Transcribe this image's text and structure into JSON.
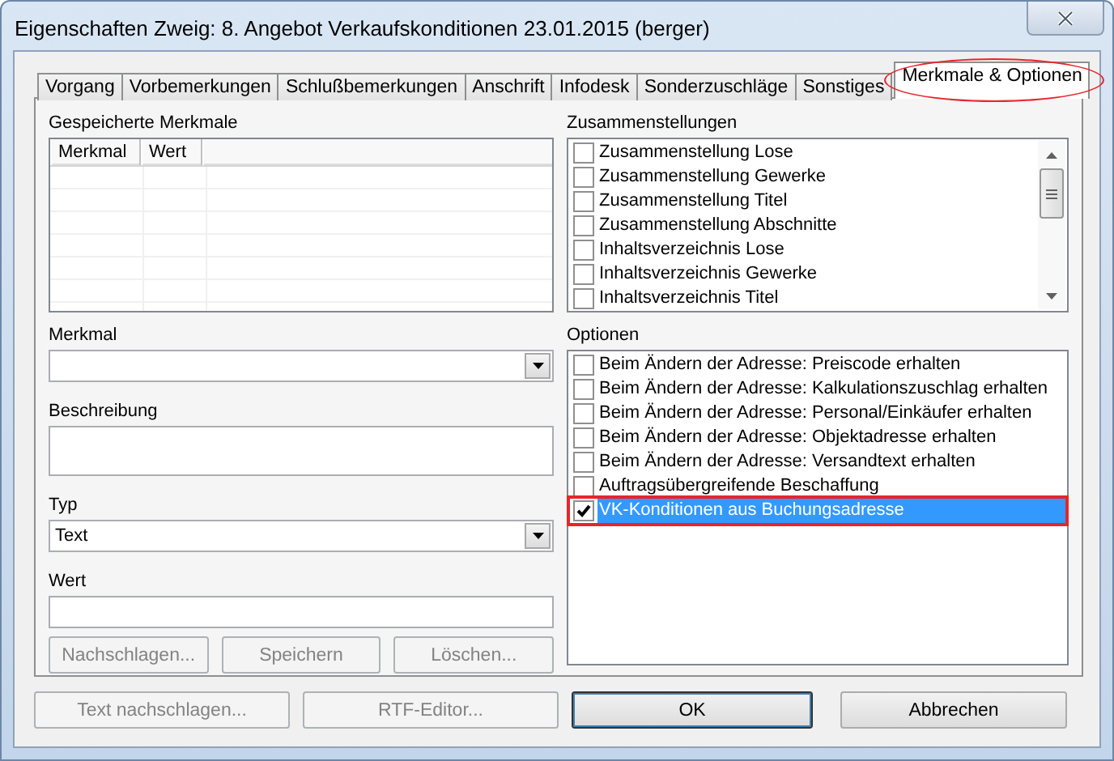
{
  "window": {
    "title": "Eigenschaften Zweig: 8. Angebot Verkaufskonditionen 23.01.2015 (berger)"
  },
  "tabs": [
    {
      "label": "Vorgang",
      "selected": false,
      "circled": false
    },
    {
      "label": "Vorbemerkungen",
      "selected": false,
      "circled": false
    },
    {
      "label": "Schlußbemerkungen",
      "selected": false,
      "circled": false
    },
    {
      "label": "Anschrift",
      "selected": false,
      "circled": false
    },
    {
      "label": "Infodesk",
      "selected": false,
      "circled": false
    },
    {
      "label": "Sonderzuschläge",
      "selected": false,
      "circled": false
    },
    {
      "label": "Sonstiges",
      "selected": false,
      "circled": false
    },
    {
      "label": "Merkmale & Optionen",
      "selected": true,
      "circled": true
    }
  ],
  "saved_features": {
    "label": "Gespeicherte Merkmale",
    "columns": [
      "Merkmal",
      "Wert"
    ]
  },
  "fields": [
    {
      "kind": "combo",
      "label": "Merkmal"
    },
    {
      "kind": "textarea",
      "label": "Beschreibung"
    },
    {
      "kind": "combo",
      "label": "Typ",
      "value": "Text"
    },
    {
      "kind": "text",
      "label": "Wert"
    }
  ],
  "field_buttons": [
    {
      "label": "Nachschlagen...",
      "disabled": true
    },
    {
      "label": "Speichern",
      "disabled": true
    },
    {
      "label": "Löschen...",
      "disabled": true
    }
  ],
  "compilations": {
    "label": "Zusammenstellungen",
    "items": [
      {
        "label": "Zusammenstellung Lose",
        "checked": false
      },
      {
        "label": "Zusammenstellung Gewerke",
        "checked": false
      },
      {
        "label": "Zusammenstellung Titel",
        "checked": false
      },
      {
        "label": "Zusammenstellung Abschnitte",
        "checked": false
      },
      {
        "label": "Inhaltsverzeichnis Lose",
        "checked": false
      },
      {
        "label": "Inhaltsverzeichnis Gewerke",
        "checked": false
      },
      {
        "label": "Inhaltsverzeichnis Titel",
        "checked": false
      }
    ]
  },
  "options": {
    "label": "Optionen",
    "items": [
      {
        "label": "Beim Ändern der Adresse: Preiscode erhalten",
        "checked": false,
        "selected": false,
        "marked": false
      },
      {
        "label": "Beim Ändern der Adresse: Kalkulationszuschlag erhalten",
        "checked": false,
        "selected": false,
        "marked": false
      },
      {
        "label": "Beim Ändern der Adresse: Personal/Einkäufer erhalten",
        "checked": false,
        "selected": false,
        "marked": false
      },
      {
        "label": "Beim Ändern der Adresse: Objektadresse erhalten",
        "checked": false,
        "selected": false,
        "marked": false
      },
      {
        "label": "Beim Ändern der Adresse: Versandtext erhalten",
        "checked": false,
        "selected": false,
        "marked": false
      },
      {
        "label": "Auftragsübergreifende Beschaffung",
        "checked": false,
        "selected": false,
        "marked": false
      },
      {
        "label": "VK-Konditionen aus Buchungsadresse",
        "checked": true,
        "selected": true,
        "marked": true
      }
    ]
  },
  "bottom_buttons": [
    {
      "label": "Text nachschlagen...",
      "disabled": true,
      "default": false
    },
    {
      "label": "RTF-Editor...",
      "disabled": true,
      "default": false
    },
    {
      "label": "OK",
      "disabled": false,
      "default": true
    },
    {
      "label": "Abbrechen",
      "disabled": false,
      "default": false
    }
  ]
}
